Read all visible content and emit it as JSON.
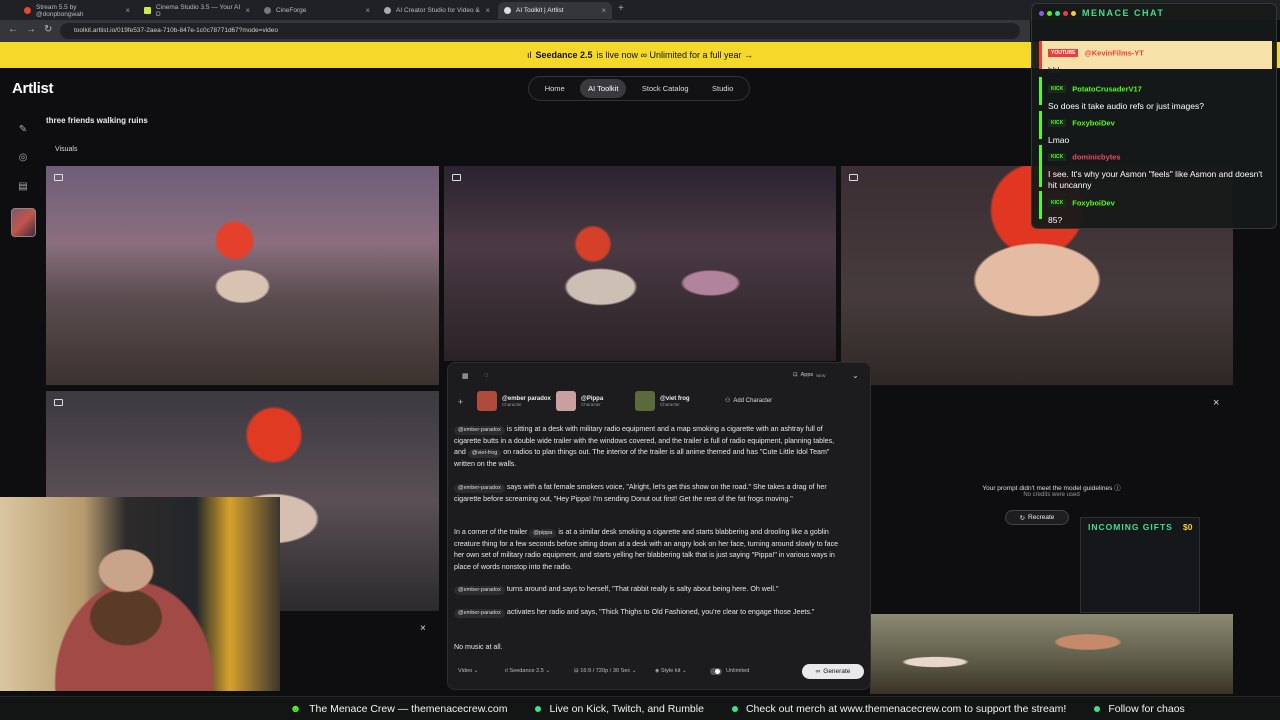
{
  "browser": {
    "tabs": [
      {
        "label": "Stream 5.5 by @donpbongwah",
        "color": "#e8492c"
      },
      {
        "label": "Cinema Studio 3.5 — Your AI D",
        "color": "#c7ee3c"
      },
      {
        "label": "CineForge",
        "color": "#777777"
      },
      {
        "label": "AI Creator Studio for Video &",
        "color": "#aaaaaa"
      },
      {
        "label": "AI Toolkit | Artlist",
        "color": "#dddddd"
      }
    ],
    "url": "toolkit.artlist.io/019fe537-2aea-710b-847e-1c0c78771d67?mode=video"
  },
  "banner": {
    "bold": "Seedance 2.5",
    "rest": "is live now ∞ Unlimited for a full year →"
  },
  "site": {
    "logo": "Artlist",
    "nav": [
      "Home",
      "AI Toolkit",
      "Stock Catalog",
      "Studio"
    ],
    "prompt_title": "three friends walking ruins",
    "visuals_label": "Visuals"
  },
  "panel": {
    "apps_label": "Apps",
    "apps_badge": "NEW",
    "characters": [
      {
        "name": "@ember paradox",
        "type": "Character",
        "color": "#b04a3a"
      },
      {
        "name": "@Pippa",
        "type": "Character",
        "color": "#c99fa0"
      },
      {
        "name": "@viet frog",
        "type": "Character",
        "color": "#5a6a3a"
      }
    ],
    "add_character": "Add Character",
    "chips": {
      "ember": "@ember-paradox",
      "frog": "@viet-frog",
      "pippa": "@pippa"
    },
    "p1_a": "is sitting at a desk with military radio equipment and a map smoking a cigarette with an ashtray full of cigarette butts in a double wide trailer with the windows covered, and the trailer is full of radio equipment, planning tables, and",
    "p1_b": "on radios to plan things out. The interior of the trailer is all anime themed and has \"Cute Little Idol Team\" written on the walls.",
    "p2": "says with a fat female smokers voice, \"Alright, let's get this show on the road.\" She takes a drag of her cigarette before screaming out, \"Hey Pippa! I'm sending Donut out first! Get the rest of the fat frogs moving.\"",
    "p3_a": "In a corner of the trailer",
    "p3_b": "is at a similar desk smoking a cigarette and starts blabbering and drooling like a goblin creature thing for a few seconds before sitting down at a desk with an angry look on her face, turning around slowly to face her own set of military radio equipment, and starts yelling her blabbering talk that is just saying \"Pippa!\" in various ways in place of words nonstop into the radio.",
    "p4": "turns around and says to herself, \"That rabbit really is salty about being here. Oh well.\"",
    "p5": "activates her radio and says, \"Thick Thighs to Old Fashioned, you're clear to engage those Jeets.\"",
    "p6": "No music at all.",
    "footer": {
      "mode": "Video",
      "model": "Seedance 2.5",
      "spec": "16:9 / 720p / 30 Sec",
      "style": "Style kit",
      "unlimited": "Unlimited",
      "generate": "Generate"
    }
  },
  "error": {
    "title": "Your prompt didn't meet the model guidelines",
    "subtitle": "No credits were used",
    "recreate": "Recreate"
  },
  "gifts": {
    "title": "INCOMING GIFTS",
    "amount": "$0"
  },
  "chat": {
    "title": "MENACE CHAT",
    "messages": [
      {
        "platform": "YOUTUBE",
        "user": "@KevinFilms-YT",
        "text": "bbl"
      },
      {
        "platform": "KICK",
        "user": "PotatoCrusaderV17",
        "text": "So does it take audio refs or just images?"
      },
      {
        "platform": "KICK",
        "user": "FoxyboiDev",
        "text": "Lmao"
      },
      {
        "platform": "KICK",
        "user": "dominicbytes",
        "text": "I see. It's why your Asmon \"feels\" like Asmon and doesn't hit uncanny"
      },
      {
        "platform": "KICK",
        "user": "FoxyboiDev",
        "text": "85?"
      }
    ]
  },
  "ticker": [
    "The Menace Crew — themenacecrew.com",
    "Live on Kick, Twitch, and Rumble",
    "Check out merch at www.themenacecrew.com to support the stream!",
    "Follow for chaos"
  ]
}
